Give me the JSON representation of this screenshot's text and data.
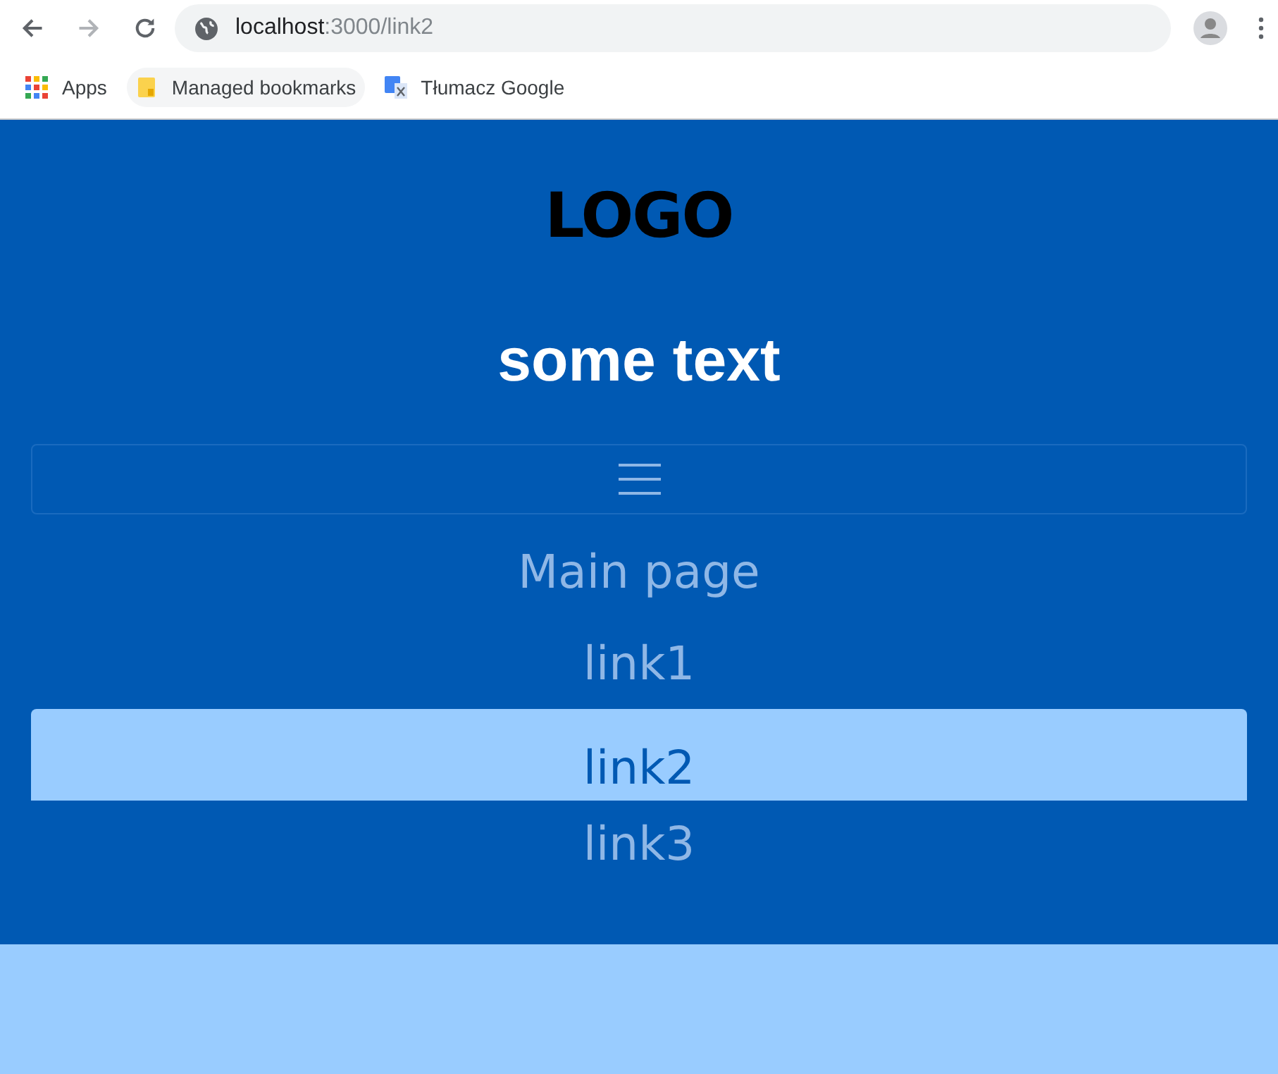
{
  "browser": {
    "url_host": "localhost",
    "url_path": ":3000/link2",
    "bookmarks": [
      {
        "label": "Apps",
        "kind": "apps"
      },
      {
        "label": "Managed bookmarks",
        "kind": "folder"
      },
      {
        "label": "Tłumacz Google",
        "kind": "translate"
      }
    ]
  },
  "header": {
    "logo": "LOGO",
    "heading": "some text"
  },
  "nav": {
    "links": [
      {
        "label": "Main page",
        "selected": false
      },
      {
        "label": "link1",
        "selected": false
      },
      {
        "label": "link2",
        "selected": true
      },
      {
        "label": "link3",
        "selected": false
      }
    ]
  }
}
